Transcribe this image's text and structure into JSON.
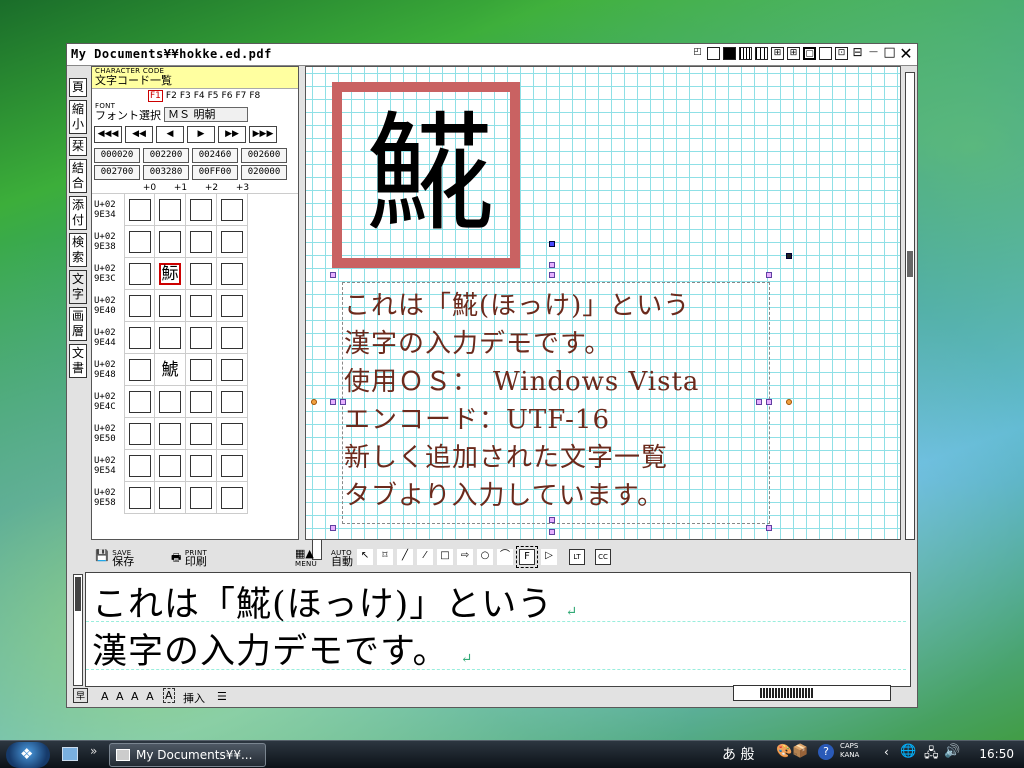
{
  "window": {
    "title": "My Documents¥¥hokke.ed.pdf",
    "title_icons": [
      "□",
      "■",
      "▦",
      "▦",
      "⊞",
      "⊞",
      "▢",
      "⊡",
      "□",
      "⊡",
      "⊡",
      "⊡",
      "⊡"
    ],
    "minimize": "—",
    "maximize": "□",
    "close": "✕"
  },
  "tabs": [
    "頁",
    "縮小",
    "栞",
    "結合",
    "添付",
    "検索",
    "文字",
    "画層",
    "文書"
  ],
  "panel": {
    "header_en": "CHARACTER CODE",
    "header_jp": "文字コード一覧",
    "fkeys": [
      "F1",
      "F2",
      "F3",
      "F4",
      "F5",
      "F6",
      "F7",
      "F8"
    ],
    "font_en": "FONT",
    "font_jp": "フォント選択",
    "font_value": "ＭＳ 明朝",
    "nav": [
      "◀◀◀",
      "◀◀",
      "◀",
      "▶",
      "▶▶",
      "▶▶▶"
    ],
    "codes": [
      "000020",
      "002200",
      "002460",
      "002600",
      "002700",
      "003280",
      "00FF00",
      "020000"
    ],
    "cols": [
      "+0",
      "+1",
      "+2",
      "+3"
    ],
    "rows": [
      {
        "a": "U+02",
        "b": "9E34",
        "cells": [
          "",
          "",
          "",
          ""
        ]
      },
      {
        "a": "U+02",
        "b": "9E38",
        "cells": [
          "",
          "",
          "",
          ""
        ]
      },
      {
        "a": "U+02",
        "b": "9E3C",
        "cells": [
          "",
          "䱈",
          "",
          ""
        ]
      },
      {
        "a": "U+02",
        "b": "9E40",
        "cells": [
          "",
          "",
          "",
          ""
        ]
      },
      {
        "a": "U+02",
        "b": "9E44",
        "cells": [
          "",
          "",
          "",
          ""
        ]
      },
      {
        "a": "U+02",
        "b": "9E48",
        "cells": [
          "",
          "鯱",
          "",
          ""
        ]
      },
      {
        "a": "U+02",
        "b": "9E4C",
        "cells": [
          "",
          "",
          "",
          ""
        ]
      },
      {
        "a": "U+02",
        "b": "9E50",
        "cells": [
          "",
          "",
          "",
          ""
        ]
      },
      {
        "a": "U+02",
        "b": "9E54",
        "cells": [
          "",
          "",
          "",
          ""
        ]
      },
      {
        "a": "U+02",
        "b": "9E58",
        "cells": [
          "",
          "",
          "",
          ""
        ]
      }
    ]
  },
  "canvas": {
    "big_char": "𩸽",
    "lines": [
      "これは「𩸽(ほっけ)」という",
      "漢字の入力デモです。",
      "使用ＯＳ：　Windows Vista",
      "エンコード：UTF-16",
      "新しく追加された文字一覧",
      "タブより入力しています。"
    ]
  },
  "toolbar": {
    "save_en": "SAVE",
    "save_jp": "保存",
    "print_en": "PRINT",
    "print_jp": "印刷",
    "menu": "MENU",
    "auto_en": "AUTO",
    "auto_jp": "自動",
    "tools": [
      "↖",
      "⌑",
      "╱",
      "⁄",
      "□",
      "⇨",
      "○",
      "⌒",
      "F",
      "▷",
      "LT",
      "CC"
    ]
  },
  "editor": {
    "lines": [
      "これは「𩸽(ほっけ)」という",
      "漢字の入力デモです。"
    ],
    "ret": "↵"
  },
  "status": {
    "icon": "早",
    "sizes": "A A A A",
    "insert": "挿入",
    "lines": "☰"
  },
  "taskbar": {
    "start_icon": "❖",
    "task_title": "My Documents¥¥...",
    "ime": "あ 般",
    "caps": "CAPS",
    "kana": "KANA",
    "time": "16:50"
  }
}
